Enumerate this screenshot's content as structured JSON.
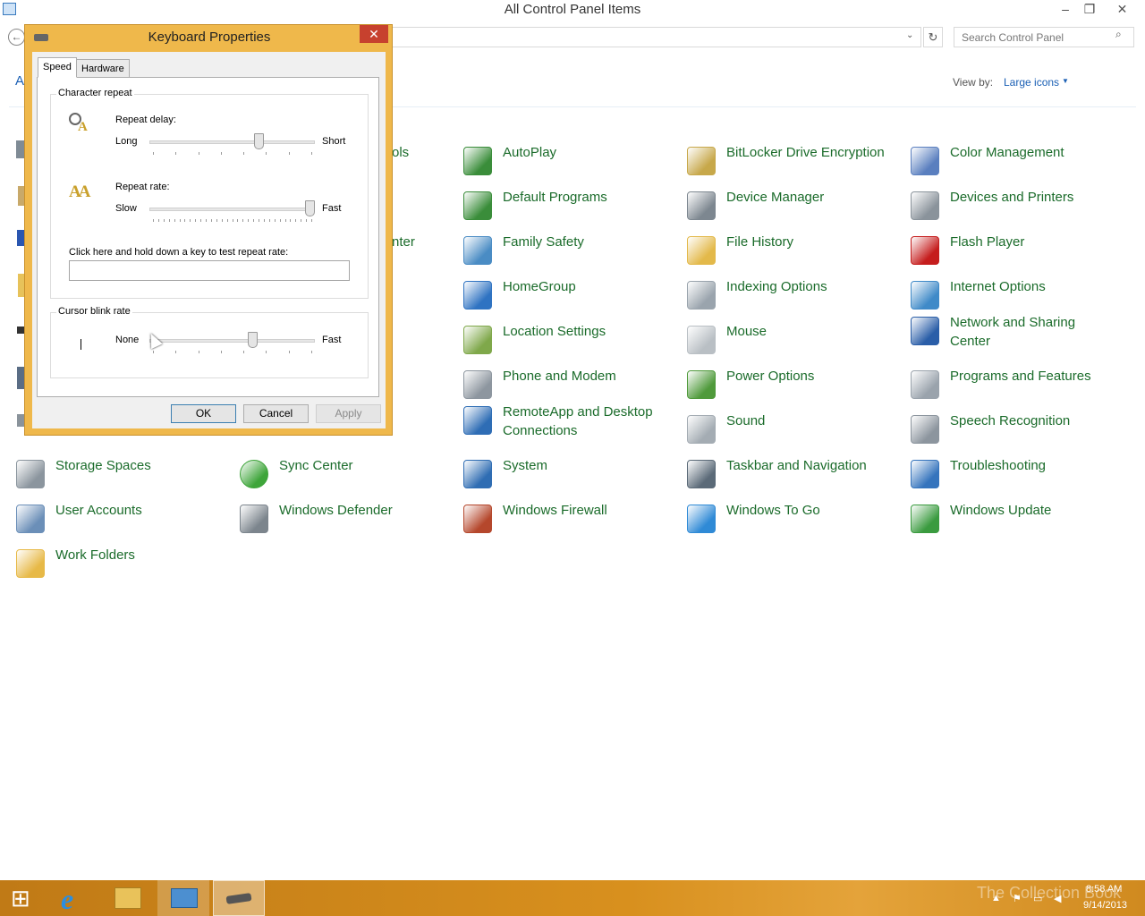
{
  "window": {
    "title": "All Control Panel Items",
    "minimize": "–",
    "maximize": "❐",
    "close": "✕"
  },
  "nav": {
    "search_placeholder": "Search Control Panel",
    "back": "←",
    "refresh": "↻",
    "dropdown": "⌄",
    "search_icon": "⌕",
    "crumb_letter": "A"
  },
  "view": {
    "label": "View by:",
    "value": "Large icons",
    "arrow": "▼"
  },
  "items": [
    {
      "label": "AutoPlay",
      "icon": "autoplay-icon",
      "color": "#3a8d3a"
    },
    {
      "label": "BitLocker Drive Encryption",
      "icon": "bitlocker-icon",
      "color": "#c7a84a"
    },
    {
      "label": "Color Management",
      "icon": "color-management-icon",
      "color": "#5a7fbf"
    },
    {
      "label": "Default Programs",
      "icon": "default-programs-icon",
      "color": "#3a8d3a"
    },
    {
      "label": "Device Manager",
      "icon": "device-manager-icon",
      "color": "#7d8790"
    },
    {
      "label": "Devices and Printers",
      "icon": "devices-printers-icon",
      "color": "#8a939b"
    },
    {
      "label": "Family Safety",
      "icon": "family-safety-icon",
      "color": "#4a8cc4"
    },
    {
      "label": "File History",
      "icon": "file-history-icon",
      "color": "#e3b94a"
    },
    {
      "label": "Flash Player",
      "icon": "flash-player-icon",
      "color": "#c51d1d"
    },
    {
      "label": "HomeGroup",
      "icon": "homegroup-icon",
      "color": "#2f73c2"
    },
    {
      "label": "Indexing Options",
      "icon": "indexing-options-icon",
      "color": "#9aa4ad"
    },
    {
      "label": "Internet Options",
      "icon": "internet-options-icon",
      "color": "#3f8ac8"
    },
    {
      "label": "Location Settings",
      "icon": "location-settings-icon",
      "color": "#7fa84a"
    },
    {
      "label": "Mouse",
      "icon": "mouse-icon",
      "color": "#b9bfc4"
    },
    {
      "label": "Network and Sharing Center",
      "icon": "network-sharing-icon",
      "color": "#2a5ea8"
    },
    {
      "label": "Phone and Modem",
      "icon": "phone-modem-icon",
      "color": "#8d969f"
    },
    {
      "label": "Power Options",
      "icon": "power-options-icon",
      "color": "#4f9a3b"
    },
    {
      "label": "Programs and Features",
      "icon": "programs-features-icon",
      "color": "#9aa3ac"
    },
    {
      "label": "RemoteApp and Desktop Connections",
      "icon": "remoteapp-icon",
      "color": "#2e6db5"
    },
    {
      "label": "Sound",
      "icon": "sound-icon",
      "color": "#a4acb3"
    },
    {
      "label": "Speech Recognition",
      "icon": "speech-recognition-icon",
      "color": "#8c959e"
    },
    {
      "label": "Storage Spaces",
      "icon": "storage-spaces-icon",
      "color": "#8b959e"
    },
    {
      "label": "Sync Center",
      "icon": "sync-center-icon",
      "color": "#3ea53a"
    },
    {
      "label": "System",
      "icon": "system-icon",
      "color": "#2f6db3"
    },
    {
      "label": "Taskbar and Navigation",
      "icon": "taskbar-navigation-icon",
      "color": "#5b6a78"
    },
    {
      "label": "Troubleshooting",
      "icon": "troubleshooting-icon",
      "color": "#3574bd"
    },
    {
      "label": "User Accounts",
      "icon": "user-accounts-icon",
      "color": "#6b8fb8"
    },
    {
      "label": "Windows Defender",
      "icon": "windows-defender-icon",
      "color": "#7c858d"
    },
    {
      "label": "Windows Firewall",
      "icon": "windows-firewall-icon",
      "color": "#b5472c"
    },
    {
      "label": "Windows To Go",
      "icon": "windows-to-go-icon",
      "color": "#2f8ad6"
    },
    {
      "label": "Windows Update",
      "icon": "windows-update-icon",
      "color": "#3a9b3f"
    },
    {
      "label": "Work Folders",
      "icon": "work-folders-icon",
      "color": "#e7b947"
    }
  ],
  "partial_items": [
    {
      "label": "ols"
    },
    {
      "label": "nter"
    }
  ],
  "dialog": {
    "title": "Keyboard Properties",
    "close": "✕",
    "tabs": [
      "Speed",
      "Hardware"
    ],
    "char_repeat": {
      "title": "Character repeat",
      "delay_label": "Repeat delay:",
      "delay_min": "Long",
      "delay_max": "Short",
      "delay_level": 0.67,
      "rate_label": "Repeat rate:",
      "rate_min": "Slow",
      "rate_max": "Fast",
      "rate_level": 1.0,
      "rate_icon": "AA",
      "test_label": "Click here and hold down a key to test repeat rate:",
      "test_value": ""
    },
    "cursor_blink": {
      "title": "Cursor blink rate",
      "min": "None",
      "max": "Fast",
      "level": 0.63
    },
    "buttons": {
      "ok": "OK",
      "cancel": "Cancel",
      "apply": "Apply"
    }
  },
  "taskbar": {
    "time": "8:58 AM",
    "date": "9/14/2013",
    "watermark": "The Collection Book",
    "start_icon": "⊞",
    "ie_icon": "e"
  },
  "colors": {
    "link_green": "#1a6b2a",
    "link_blue": "#1a5fb4",
    "dialog_frame": "#efb84b",
    "close_red": "#c7412e",
    "taskbar": "#d08a1f"
  }
}
